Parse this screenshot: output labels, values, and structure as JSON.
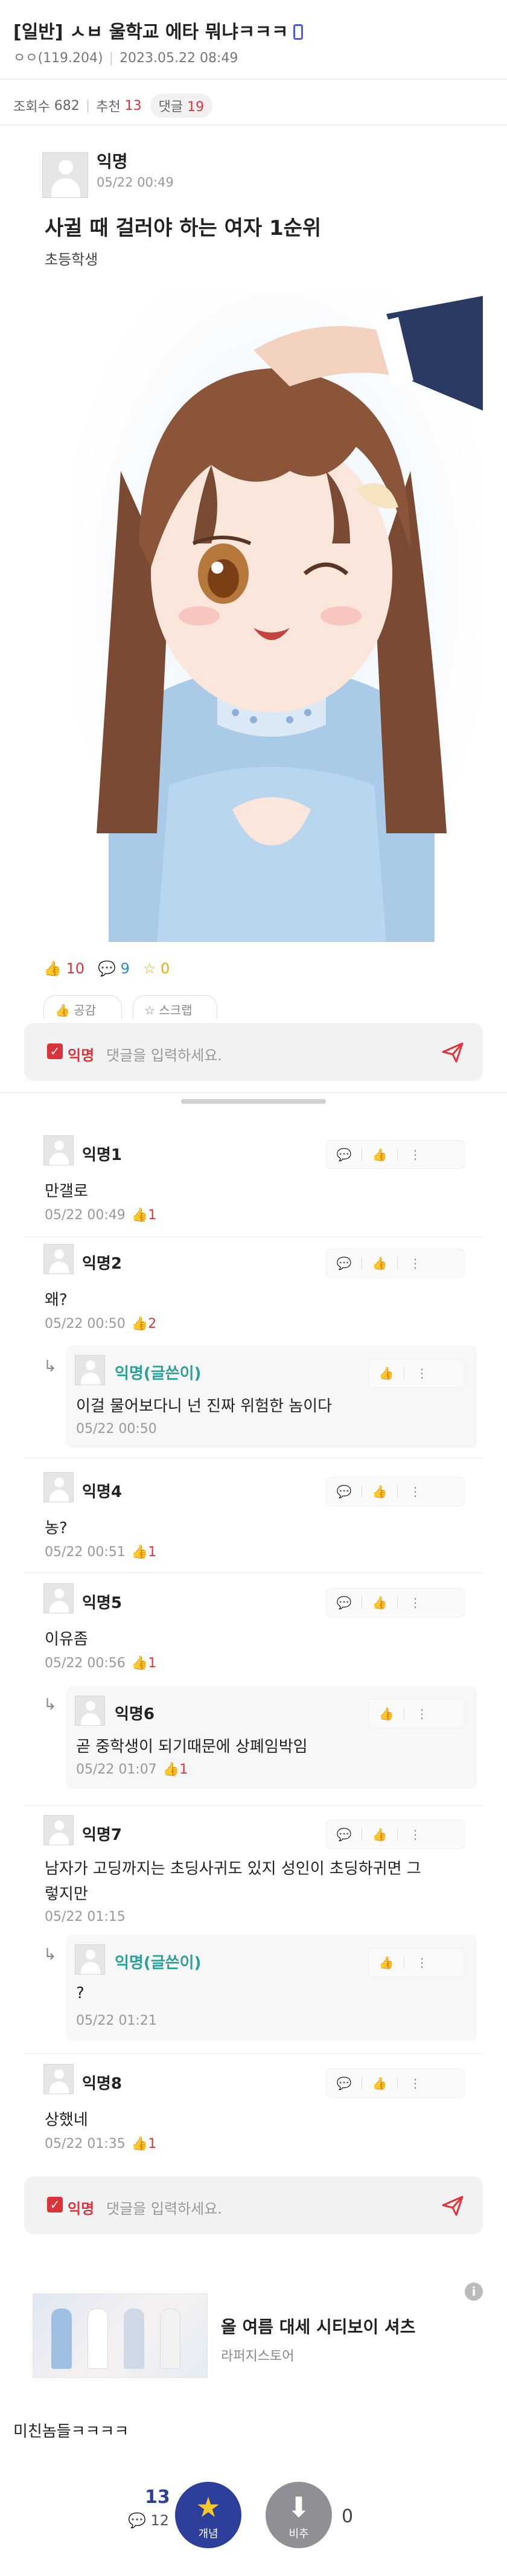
{
  "header": {
    "title": "[일반] ㅅㅂ 울학교 에타 뭐냐ㅋㅋㅋ",
    "author": "ㅇㅇ(119.204)",
    "datetime": "2023.05.22 08:49"
  },
  "stats": {
    "views_label": "조회수",
    "views": "682",
    "recommend_label": "추천",
    "recommend": "13",
    "comments_label": "댓글",
    "comments": "19"
  },
  "post": {
    "author": "익명",
    "date": "05/22 00:49",
    "title": "사귈 때 걸러야 하는 여자 1순위",
    "body": "초등학생",
    "likes": "10",
    "comment_count": "9",
    "scraps": "0",
    "chip_like": "공감",
    "chip_scrap": "스크랩"
  },
  "comment_input": {
    "user": "익명",
    "placeholder": "댓글을 입력하세요."
  },
  "comments": [
    {
      "author": "익명1",
      "body": "만갤로",
      "date": "05/22 00:49",
      "likes": "1"
    },
    {
      "author": "익명2",
      "body": "왜?",
      "date": "05/22 00:50",
      "likes": "2"
    },
    {
      "author": "익명(글쓴이)",
      "body": "이걸 물어보다니 넌 진짜 위험한 놈이다",
      "date": "05/22 00:50",
      "likes": ""
    },
    {
      "author": "익명4",
      "body": "농?",
      "date": "05/22 00:51",
      "likes": "1"
    },
    {
      "author": "익명5",
      "body": "이유좀",
      "date": "05/22 00:56",
      "likes": "1"
    },
    {
      "author": "익명6",
      "body": "곧 중학생이 되기때문에 상폐임박임",
      "date": "05/22 01:07",
      "likes": "1"
    },
    {
      "author": "익명7",
      "body_line1": "남자가 고딩까지는 초딩사귀도 있지 성인이 초딩하귀면 그",
      "body_line2": "렇지만",
      "date": "05/22 01:15",
      "likes": ""
    },
    {
      "author": "익명(글쓴이)",
      "body": "?",
      "date": "05/22 01:21",
      "likes": ""
    },
    {
      "author": "익명8",
      "body": "상했네",
      "date": "05/22 01:35",
      "likes": "1"
    }
  ],
  "ad": {
    "title": "올 여름 대세 시티보이 셔츠",
    "source": "라퍼지스토어",
    "info": "i"
  },
  "footer_text": "미친놈들ㅋㅋㅋㅋ",
  "vote": {
    "up_count": "13",
    "comment_count": "12",
    "up_label": "개념",
    "down_label": "비추",
    "down_count": "0"
  },
  "colors": {
    "accent_red": "#e0333b",
    "op_teal": "#2aa29a",
    "vote_blue": "#2e3f9b",
    "vote_gray": "#8e9095"
  },
  "icons": {
    "like": "thumbs-up-icon",
    "comment": "speech-bubble-icon",
    "star": "star-icon",
    "send": "paper-plane-icon",
    "more": "more-dots-icon"
  }
}
